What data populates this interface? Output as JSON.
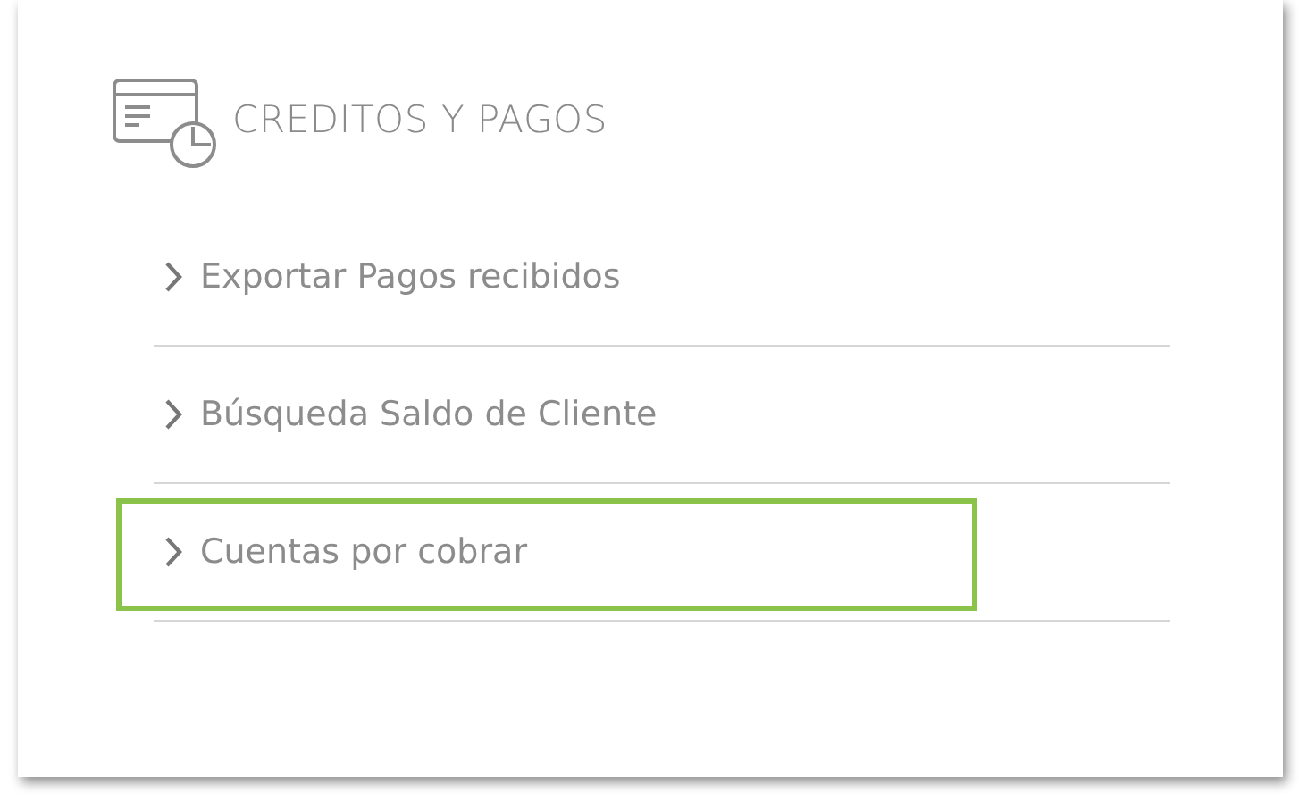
{
  "section": {
    "title": "CREDITOS Y PAGOS"
  },
  "items": [
    {
      "label": "Exportar Pagos recibidos",
      "highlighted": false
    },
    {
      "label": "Búsqueda Saldo de Cliente",
      "highlighted": false
    },
    {
      "label": "Cuentas por cobrar",
      "highlighted": true
    }
  ]
}
